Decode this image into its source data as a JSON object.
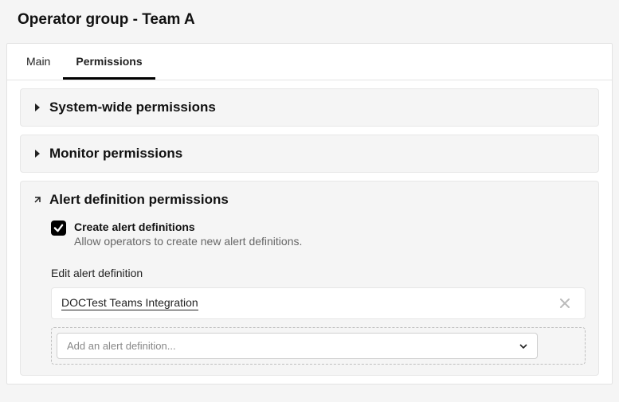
{
  "page_title": "Operator group - Team A",
  "tabs": [
    {
      "label": "Main",
      "active": false
    },
    {
      "label": "Permissions",
      "active": true
    }
  ],
  "panels": {
    "system_wide": {
      "title": "System-wide permissions"
    },
    "monitor": {
      "title": "Monitor permissions"
    },
    "alert_def": {
      "title": "Alert definition permissions",
      "create_checkbox": {
        "checked": true,
        "label": "Create alert definitions",
        "description": "Allow operators to create new alert definitions."
      },
      "edit_section": {
        "label": "Edit alert definition",
        "items": [
          "DOCTest Teams Integration"
        ],
        "add_placeholder": "Add an alert definition..."
      }
    }
  }
}
